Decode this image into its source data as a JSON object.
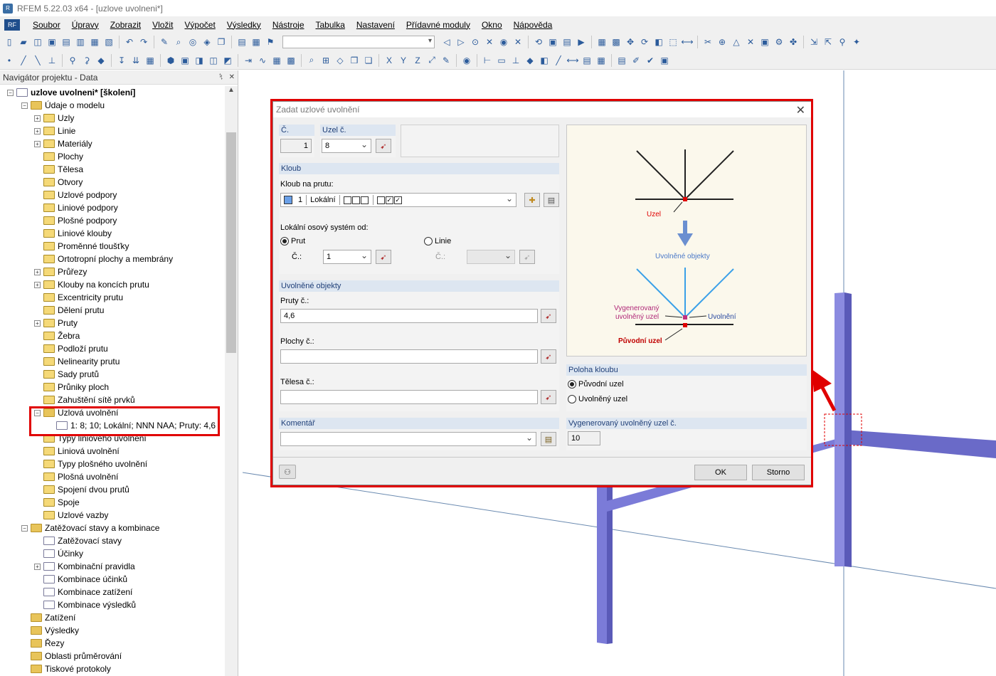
{
  "window": {
    "title": "RFEM 5.22.03 x64 - [uzlove uvolneni*]"
  },
  "menu": {
    "items": [
      "Soubor",
      "Úpravy",
      "Zobrazit",
      "Vložit",
      "Výpočet",
      "Výsledky",
      "Nástroje",
      "Tabulka",
      "Nastavení",
      "Přídavné moduly",
      "Okno",
      "Nápověda"
    ]
  },
  "navigator": {
    "title": "Navigátor projektu - Data",
    "project": "uzlove uvolneni* [školení]",
    "model_data": "Údaje o modelu",
    "items": [
      "Uzly",
      "Linie",
      "Materiály",
      "Plochy",
      "Tělesa",
      "Otvory",
      "Uzlové podpory",
      "Liniové podpory",
      "Plošné podpory",
      "Liniové klouby",
      "Proměnné tloušťky",
      "Ortotropní plochy a membrány",
      "Průřezy",
      "Klouby na koncích prutu",
      "Excentricity prutu",
      "Dělení prutu",
      "Pruty",
      "Žebra",
      "Podloží prutu",
      "Nelinearity prutu",
      "Sady prutů",
      "Průniky ploch",
      "Zahuštění sítě prvků",
      "Uzlová uvolnění"
    ],
    "release_entry": "1: 8; 10; Lokální; NNN NAA; Pruty: 4,6",
    "items_after": [
      "Typy liniového uvolnění",
      "Liniová uvolnění",
      "Typy plošného uvolnění",
      "Plošná uvolnění",
      "Spojení dvou prutů",
      "Spoje",
      "Uzlové vazby"
    ],
    "load_cases": "Zatěžovací stavy a kombinace",
    "load_items": [
      "Zatěžovací stavy",
      "Účinky",
      "Kombinační pravidla",
      "Kombinace účinků",
      "Kombinace zatížení",
      "Kombinace výsledků"
    ],
    "root_items": [
      "Zatížení",
      "Výsledky",
      "Řezy",
      "Oblasti průměrování",
      "Tiskové protokoly"
    ]
  },
  "dialog": {
    "title": "Zadat uzlové uvolnění",
    "no_label": "Č.",
    "no_value": "1",
    "node_label": "Uzel č.",
    "node_value": "8",
    "hinge_group": "Kloub",
    "hinge_on_member_label": "Kloub na prutu:",
    "hinge_value_no": "1",
    "hinge_value_type": "Lokální",
    "local_axis_label": "Lokální osový systém od:",
    "radio_member": "Prut",
    "radio_line": "Linie",
    "member_no_label": "Č.:",
    "member_no_value": "1",
    "line_no_label": "Č.:",
    "released_group": "Uvolněné objekty",
    "members_label": "Pruty č.:",
    "members_value": "4,6",
    "surfaces_label": "Plochy č.:",
    "surfaces_value": "",
    "solids_label": "Tělesa č.:",
    "solids_value": "",
    "comment_group": "Komentář",
    "comment_value": "",
    "hinge_pos_group": "Poloha kloubu",
    "pos_original": "Původní uzel",
    "pos_released": "Uvolněný uzel",
    "generated_group": "Vygenerovaný uvolněný uzel č.",
    "generated_value": "10",
    "ok": "OK",
    "cancel": "Storno",
    "diagram": {
      "node": "Uzel",
      "released_objects": "Uvolněné objekty",
      "generated_line1": "Vygenerovaný",
      "generated_line2": "uvolněný uzel",
      "released": "Uvolnění",
      "original_node": "Původní uzel"
    }
  },
  "colors": {
    "highlight": "#e00000",
    "member": "#7b7bd8",
    "header_blue": "#dde6f1"
  }
}
